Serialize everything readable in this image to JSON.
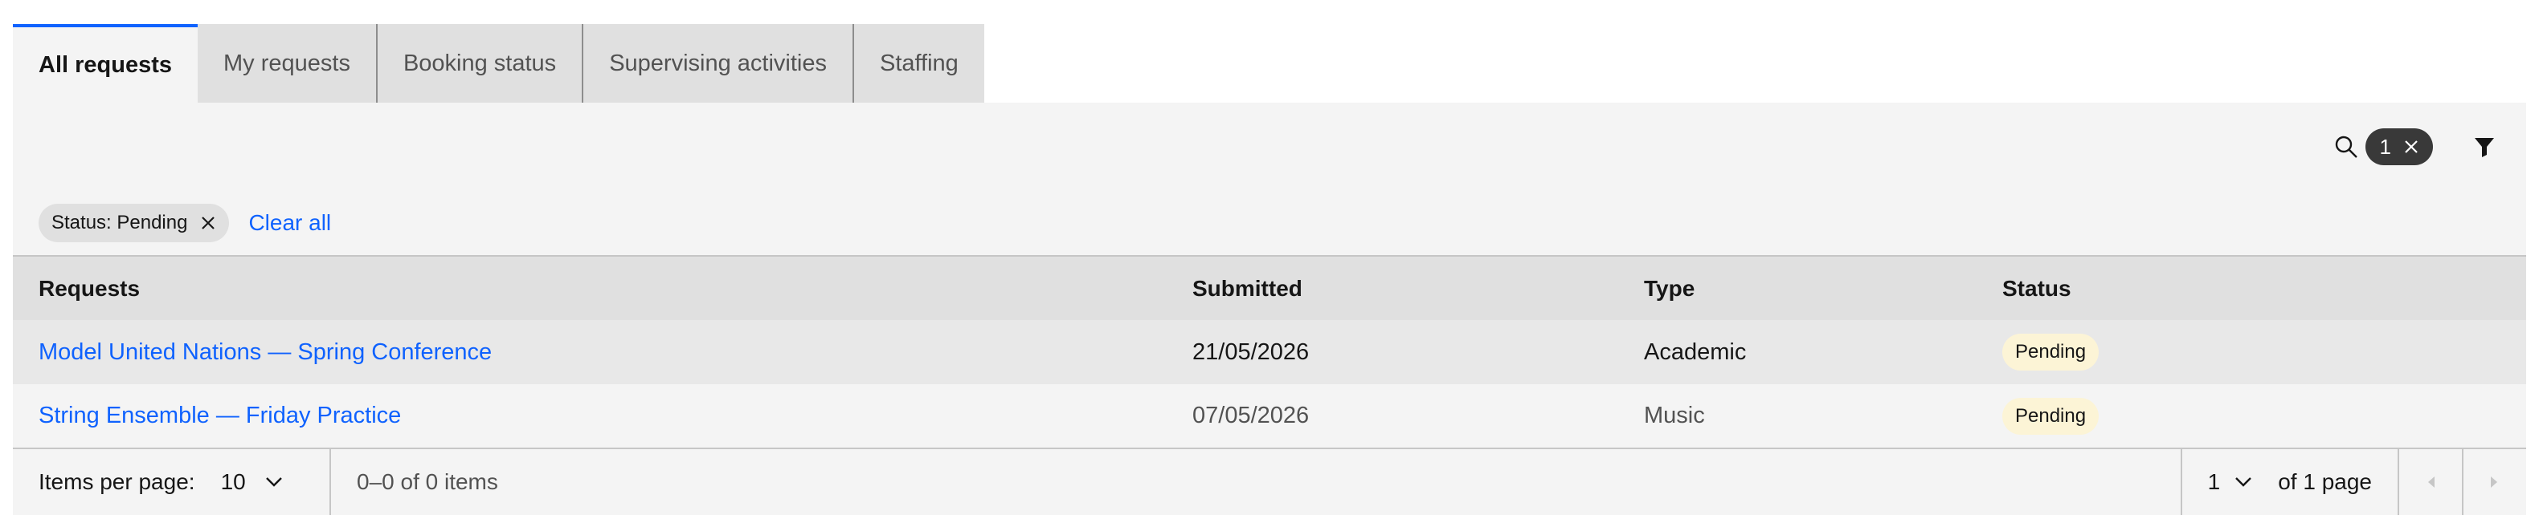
{
  "tabs": [
    {
      "label": "All requests",
      "active": true
    },
    {
      "label": "My requests",
      "active": false
    },
    {
      "label": "Booking status",
      "active": false
    },
    {
      "label": "Supervising activities",
      "active": false
    },
    {
      "label": "Staffing",
      "active": false
    }
  ],
  "toolbar": {
    "search_icon": "search-icon",
    "filter_count": "1",
    "filter_icon": "filter-icon"
  },
  "filters": {
    "tags": [
      {
        "label": "Status: Pending"
      }
    ],
    "clear_all": "Clear all"
  },
  "table": {
    "headers": [
      "Requests",
      "Submitted",
      "Type",
      "Status"
    ],
    "rows": [
      {
        "request": "Model United Nations — Spring Conference",
        "submitted": "21/05/2026",
        "type": "Academic",
        "status": "Pending"
      },
      {
        "request": "String Ensemble — Friday Practice",
        "submitted": "07/05/2026",
        "type": "Music",
        "status": "Pending"
      }
    ]
  },
  "pagination": {
    "items_per_page_label": "Items per page:",
    "items_per_page_value": "10",
    "range": "0–0 of 0 items",
    "page_value": "1",
    "of_pages": "of 1 page"
  },
  "colors": {
    "accent": "#0f62fe",
    "status_pending_bg": "#fcf4d6",
    "tag_dark": "#393939"
  }
}
